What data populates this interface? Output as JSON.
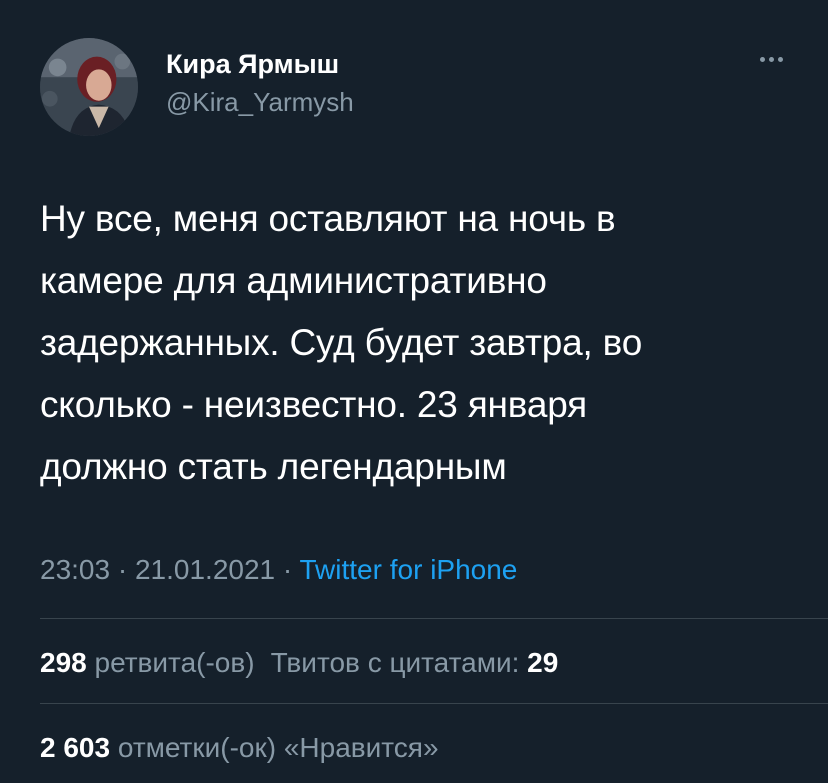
{
  "author": {
    "display_name": "Кира Ярмыш",
    "handle": "@Kira_Yarmysh",
    "avatar": "profile-photo"
  },
  "tweet": {
    "lines": [
      "Ну все, меня оставляют на ночь в",
      "камере для административно",
      "задержанных. Суд будет завтра, во",
      "сколько - неизвестно. 23 января",
      "должно стать легендарным"
    ]
  },
  "meta": {
    "time": "23:03",
    "separator": " · ",
    "date": "21.01.2021",
    "source": "Twitter for iPhone"
  },
  "stats": {
    "retweets_count": "298",
    "retweets_label": "ретвита(-ов)",
    "quotes_label": "Твитов с цитатами:",
    "quotes_count": "29",
    "likes_count": "2 603",
    "likes_label": "отметки(-ок) «Нравится»"
  },
  "icons": {
    "more": "more-horizontal-icon"
  },
  "colors": {
    "background": "#15202b",
    "text_primary": "#ffffff",
    "text_secondary": "#8899a6",
    "link": "#1da1f2",
    "divider": "#38444d"
  }
}
